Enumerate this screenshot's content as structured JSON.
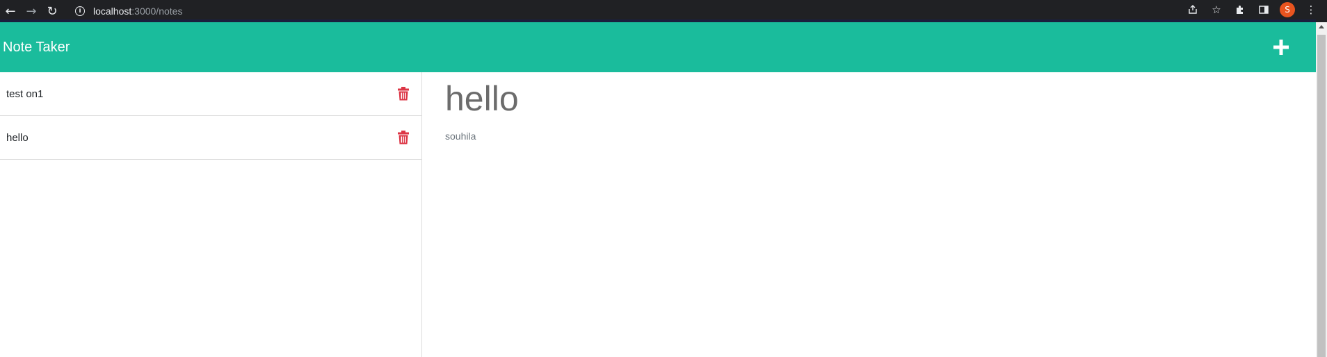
{
  "browser": {
    "url_host": "localhost",
    "url_path": ":3000/notes",
    "profile_initial": "S"
  },
  "header": {
    "title": "Note Taker"
  },
  "notes": [
    {
      "title": "test on1"
    },
    {
      "title": "hello"
    }
  ],
  "active_note": {
    "title": "hello",
    "text": "souhila"
  },
  "colors": {
    "accent": "#1abc9c",
    "trash": "#dc3545"
  }
}
